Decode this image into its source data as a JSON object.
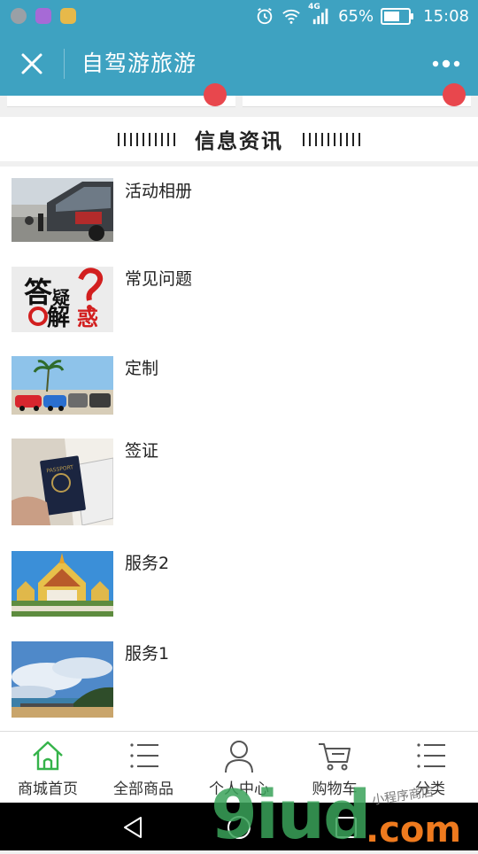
{
  "status_bar": {
    "network": "4G",
    "battery": "65%",
    "battery_level": 0.65,
    "time": "15:08",
    "left_icons": [
      "notification-app-icon",
      "gallery-app-icon",
      "message-app-icon"
    ]
  },
  "header": {
    "title": "自驾游旅游",
    "close_icon": "close-icon",
    "more_icon": "more-icon"
  },
  "section": {
    "title": "信息资讯"
  },
  "news": [
    {
      "title": "活动相册",
      "thumb": "car-event-photo"
    },
    {
      "title": "常见问题",
      "thumb": "faq-calligraphy-image"
    },
    {
      "title": "定制",
      "thumb": "cars-on-beach-photo"
    },
    {
      "title": "签证",
      "thumb": "passport-photo"
    },
    {
      "title": "服务2",
      "thumb": "thai-temple-photo"
    },
    {
      "title": "服务1",
      "thumb": "seaside-sky-photo"
    }
  ],
  "faq_image_text": {
    "line1": "答",
    "line2": "疑",
    "line3": "解",
    "line4": "惑"
  },
  "tabbar": {
    "items": [
      {
        "label": "商城首页",
        "icon": "home-icon",
        "active": true
      },
      {
        "label": "全部商品",
        "icon": "list-icon",
        "active": false
      },
      {
        "label": "个人中心",
        "icon": "user-icon",
        "active": false
      },
      {
        "label": "购物车",
        "icon": "cart-icon",
        "active": false
      },
      {
        "label": "分类",
        "icon": "category-list-icon",
        "active": false
      }
    ]
  },
  "watermark": {
    "main": "9iud",
    "tld": ".com",
    "small": "小程序商店"
  },
  "colors": {
    "header_bg": "#3ea2c1",
    "badge": "#e8474d",
    "active_tab": "#35b34a"
  }
}
